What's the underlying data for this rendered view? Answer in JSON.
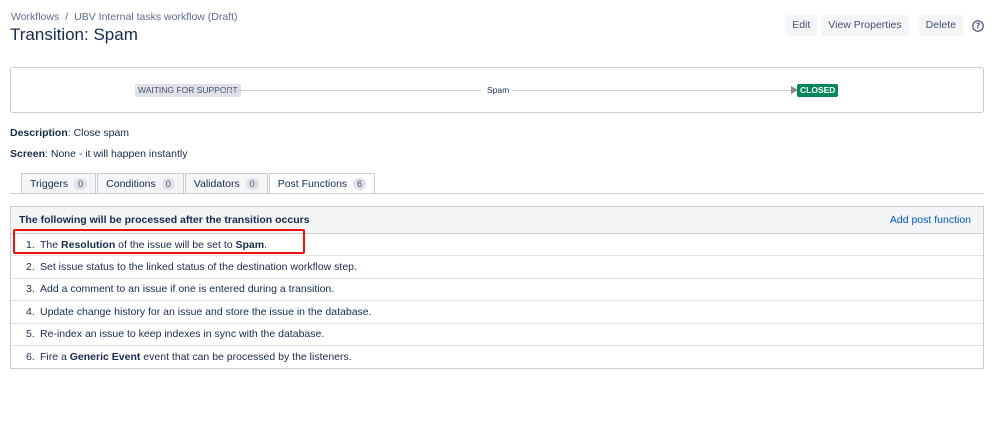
{
  "breadcrumb": {
    "root": "Workflows",
    "separator": "/",
    "current": "UBV Internal tasks workflow (Draft)"
  },
  "page": {
    "title": "Transition: Spam"
  },
  "actions": {
    "edit": "Edit",
    "view_properties": "View Properties",
    "delete": "Delete",
    "help_icon": "question-circle-icon"
  },
  "diagram": {
    "from_status": "WAITING FOR SUPPORT",
    "transition": "Spam",
    "to_status": "CLOSED",
    "to_status_color": "#00875a"
  },
  "description": {
    "label": "Description",
    "value": ": Close spam"
  },
  "screen": {
    "label": "Screen",
    "value": ": None - it will happen instantly"
  },
  "tabs": [
    {
      "label": "Triggers",
      "count": "0"
    },
    {
      "label": "Conditions",
      "count": "0"
    },
    {
      "label": "Validators",
      "count": "0"
    },
    {
      "label": "Post Functions",
      "count": "6"
    }
  ],
  "post_functions": {
    "header": "The following will be processed after the transition occurs",
    "add_link": "Add post function",
    "items": [
      {
        "num": "1.",
        "t1": "The ",
        "b1": "Resolution",
        "t2": " of the issue will be set to ",
        "b2": "Spam",
        "t3": "."
      },
      {
        "num": "2.",
        "t1": "Set issue status to the linked status of the destination workflow step."
      },
      {
        "num": "3.",
        "t1": "Add a comment to an issue if one is entered during a transition."
      },
      {
        "num": "4.",
        "t1": "Update change history for an issue and store the issue in the database."
      },
      {
        "num": "5.",
        "t1": "Re-index an issue to keep indexes in sync with the database."
      },
      {
        "num": "6.",
        "t1": "Fire a ",
        "b1": "Generic Event",
        "t2": " event that can be processed by the listeners."
      }
    ]
  },
  "colors": {
    "highlight": "#ee1111",
    "link": "#0052cc"
  }
}
